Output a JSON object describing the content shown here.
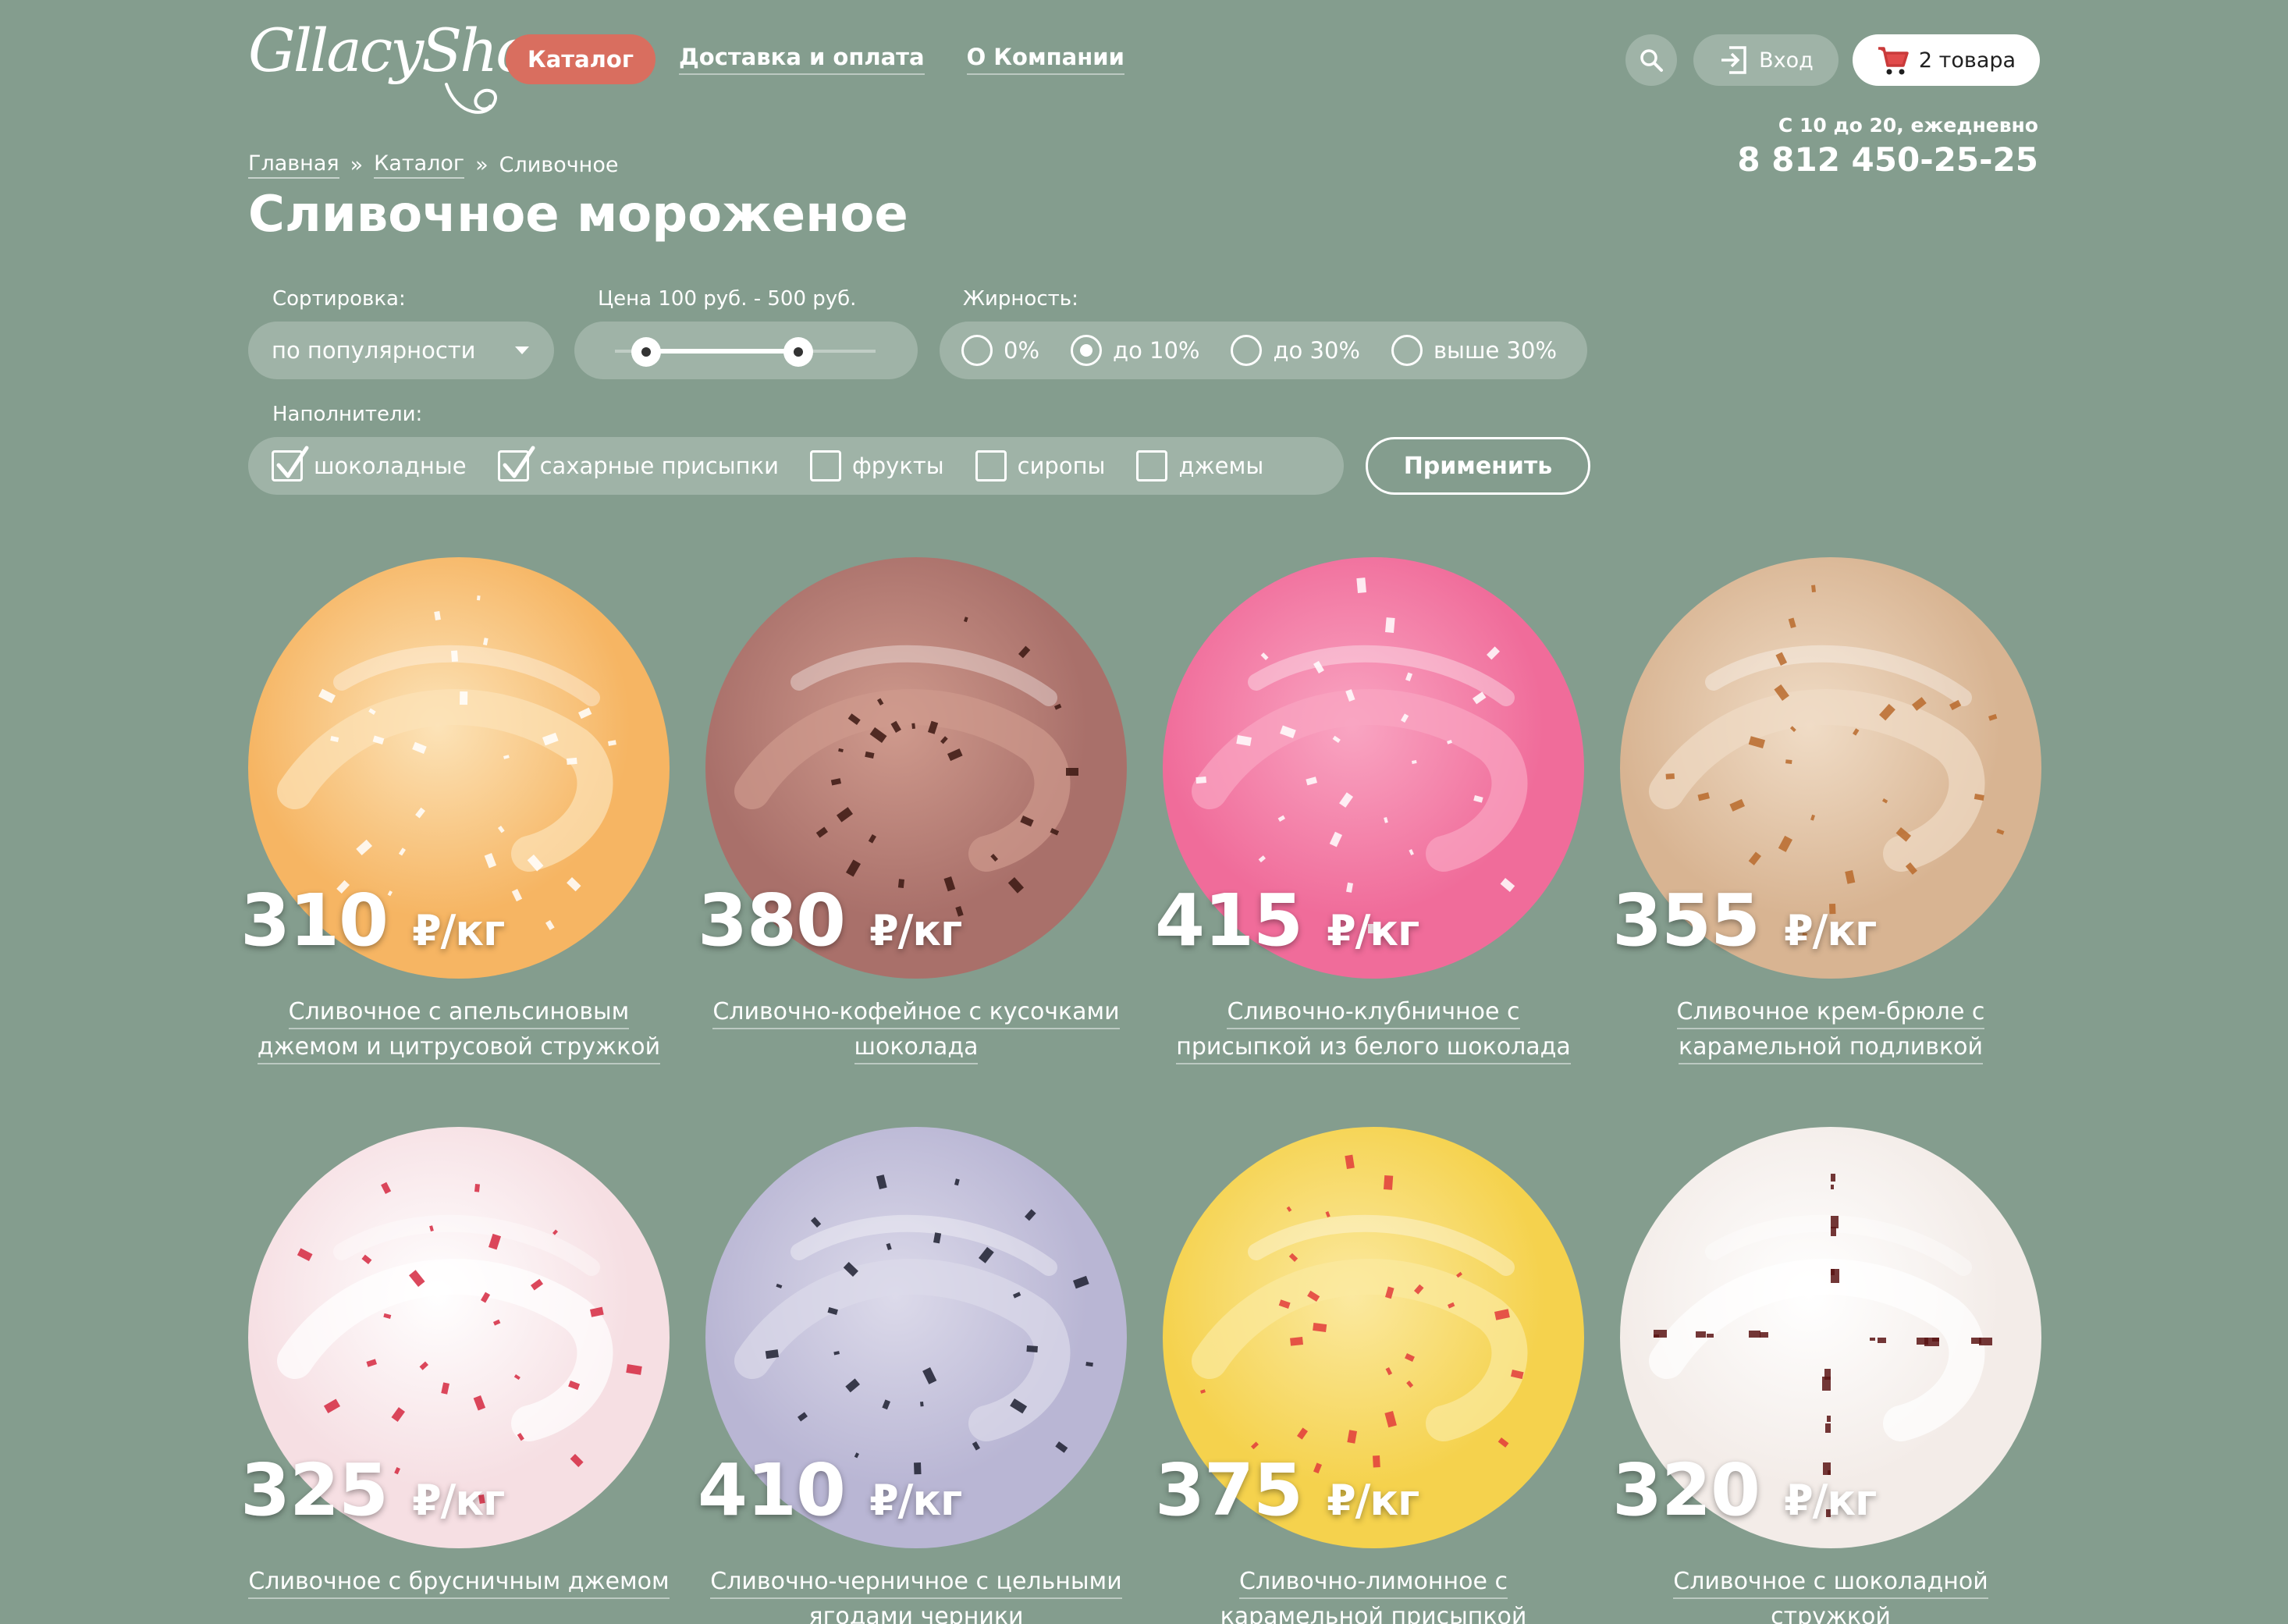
{
  "header": {
    "logo_text": "GllacyShop",
    "nav": [
      {
        "label": "Каталог",
        "active": true
      },
      {
        "label": "Доставка и оплата",
        "active": false
      },
      {
        "label": "О Компании",
        "active": false
      }
    ],
    "login_label": "Вход",
    "cart_label": "2 товара",
    "hours": "С 10 до 20, ежедневно",
    "phone": "8 812 450-25-25"
  },
  "breadcrumb": {
    "items": [
      "Главная",
      "Каталог",
      "Сливочное"
    ],
    "separator": "»"
  },
  "page_title": "Сливочное мороженое",
  "filters": {
    "sort": {
      "label": "Сортировка:",
      "value": "по популярности"
    },
    "price": {
      "label": "Цена 100 руб. - 500 руб.",
      "min": 100,
      "max": 500
    },
    "fat": {
      "label": "Жирность:",
      "options": [
        {
          "label": "0%",
          "checked": false
        },
        {
          "label": "до 10%",
          "checked": true
        },
        {
          "label": "до 30%",
          "checked": false
        },
        {
          "label": "выше 30%",
          "checked": false
        }
      ]
    },
    "fillers": {
      "label": "Наполнители:",
      "options": [
        {
          "label": "шоколадные",
          "checked": true
        },
        {
          "label": "сахарные присыпки",
          "checked": true
        },
        {
          "label": "фрукты",
          "checked": false
        },
        {
          "label": "сиропы",
          "checked": false
        },
        {
          "label": "джемы",
          "checked": false
        }
      ]
    },
    "apply_label": "Применить"
  },
  "price_unit": "₽/кг",
  "products": [
    {
      "price": "310",
      "name": "Сливочное с апельсиновым джемом и цитрусовой стружкой",
      "colors": [
        "#f6b563",
        "#fce3b8",
        "#ffffff"
      ]
    },
    {
      "price": "380",
      "name": "Сливочно-кофейное с кусочками шоколада",
      "colors": [
        "#a9706a",
        "#cf9a8d",
        "#3b1712"
      ]
    },
    {
      "price": "415",
      "name": "Сливочно-клубничное с присыпкой из белого шоколада",
      "colors": [
        "#f06c9a",
        "#f9a5c2",
        "#ffffff"
      ]
    },
    {
      "price": "355",
      "name": "Сливочное крем-брюле с карамельной подливкой",
      "colors": [
        "#d8b492",
        "#f0dcc6",
        "#b86a2c"
      ]
    },
    {
      "price": "325",
      "name": "Сливочное с брусничным джемом",
      "colors": [
        "#f6dfe3",
        "#ffffff",
        "#d5283f"
      ]
    },
    {
      "price": "410",
      "name": "Сливочно-черничное с цельными ягодами черники",
      "colors": [
        "#b9b6d4",
        "#dcdaea",
        "#1d2030"
      ]
    },
    {
      "price": "375",
      "name": "Сливочно-лимонное с карамельной присыпкой",
      "colors": [
        "#f5d24d",
        "#fbe9a0",
        "#e23b3b"
      ]
    },
    {
      "price": "320",
      "name": "Сливочное с шоколадной стружкой",
      "colors": [
        "#f3ece8",
        "#ffffff",
        "#5a1414"
      ]
    }
  ]
}
